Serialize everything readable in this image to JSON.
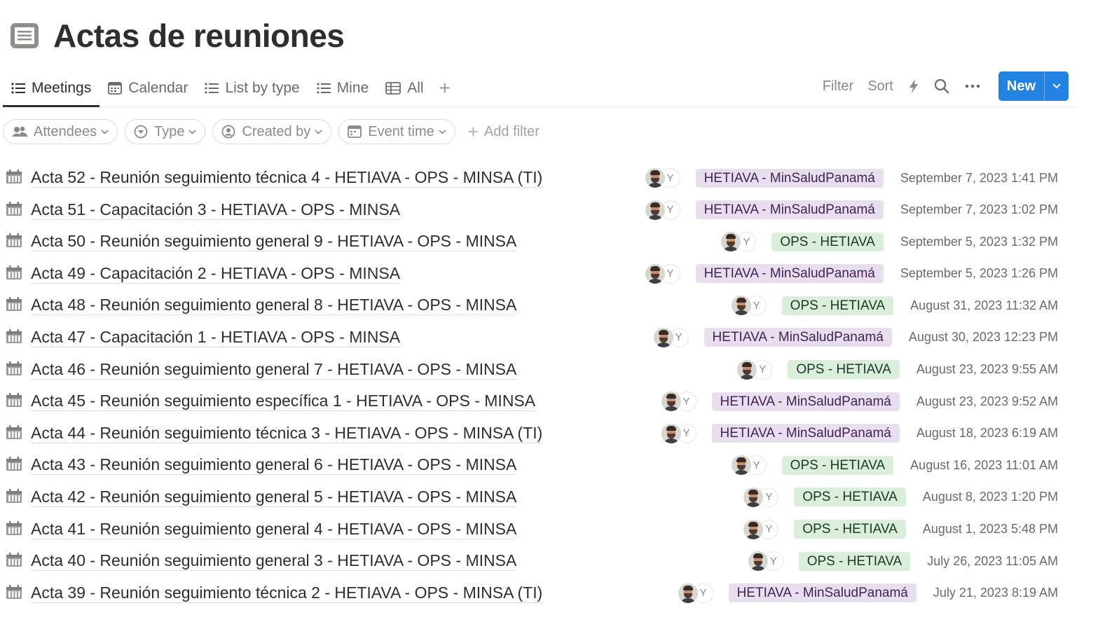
{
  "page": {
    "title": "Actas de reuniones",
    "icon": "document-icon"
  },
  "tabs": [
    {
      "label": "Meetings",
      "icon": "list-icon",
      "active": true
    },
    {
      "label": "Calendar",
      "icon": "calendar-icon",
      "active": false
    },
    {
      "label": "List by type",
      "icon": "list-icon",
      "active": false
    },
    {
      "label": "Mine",
      "icon": "list-icon",
      "active": false
    },
    {
      "label": "All",
      "icon": "table-icon",
      "active": false
    }
  ],
  "toolbar": {
    "filter_label": "Filter",
    "sort_label": "Sort",
    "new_label": "New"
  },
  "filters": [
    {
      "label": "Attendees",
      "icon": "people-icon"
    },
    {
      "label": "Type",
      "icon": "select-icon"
    },
    {
      "label": "Created by",
      "icon": "person-icon"
    },
    {
      "label": "Event time",
      "icon": "calendar-icon"
    }
  ],
  "add_filter_label": "Add filter",
  "rows": [
    {
      "title": "Acta 52 - Reunión seguimiento técnica 4 - HETIAVA - OPS - MINSA (TI)",
      "tag": "HETIAVA - MinSaludPanamá",
      "tag_color": "purple",
      "date": "September 7, 2023 1:41 PM",
      "avatar_initial": "Y"
    },
    {
      "title": "Acta 51 - Capacitación 3 - HETIAVA - OPS - MINSA",
      "tag": "HETIAVA - MinSaludPanamá",
      "tag_color": "purple",
      "date": "September 7, 2023 1:02 PM",
      "avatar_initial": "Y"
    },
    {
      "title": "Acta 50 - Reunión seguimiento general 9 - HETIAVA - OPS - MINSA",
      "tag": "OPS - HETIAVA",
      "tag_color": "green",
      "date": "September 5, 2023 1:32 PM",
      "avatar_initial": "Y"
    },
    {
      "title": "Acta 49 - Capacitación 2 - HETIAVA - OPS - MINSA",
      "tag": "HETIAVA - MinSaludPanamá",
      "tag_color": "purple",
      "date": "September 5, 2023 1:26 PM",
      "avatar_initial": "Y"
    },
    {
      "title": "Acta 48 - Reunión seguimiento general 8 - HETIAVA - OPS - MINSA",
      "tag": "OPS - HETIAVA",
      "tag_color": "green",
      "date": "August 31, 2023 11:32 AM",
      "avatar_initial": "Y"
    },
    {
      "title": "Acta 47 - Capacitación 1 - HETIAVA - OPS - MINSA",
      "tag": "HETIAVA - MinSaludPanamá",
      "tag_color": "purple",
      "date": "August 30, 2023 12:23 PM",
      "avatar_initial": "Y"
    },
    {
      "title": "Acta 46 - Reunión seguimiento general 7 - HETIAVA - OPS - MINSA",
      "tag": "OPS - HETIAVA",
      "tag_color": "green",
      "date": "August 23, 2023 9:55 AM",
      "avatar_initial": "Y"
    },
    {
      "title": "Acta 45 - Reunión seguimiento específica 1 - HETIAVA - OPS - MINSA",
      "tag": "HETIAVA - MinSaludPanamá",
      "tag_color": "purple",
      "date": "August 23, 2023 9:52 AM",
      "avatar_initial": "Y"
    },
    {
      "title": "Acta 44 - Reunión seguimiento técnica 3 - HETIAVA - OPS - MINSA (TI)",
      "tag": "HETIAVA - MinSaludPanamá",
      "tag_color": "purple",
      "date": "August 18, 2023 6:19 AM",
      "avatar_initial": "Y"
    },
    {
      "title": "Acta 43 - Reunión seguimiento general 6 - HETIAVA - OPS - MINSA",
      "tag": "OPS - HETIAVA",
      "tag_color": "green",
      "date": "August 16, 2023 11:01 AM",
      "avatar_initial": "Y"
    },
    {
      "title": "Acta 42 - Reunión seguimiento general 5 - HETIAVA - OPS - MINSA",
      "tag": "OPS - HETIAVA",
      "tag_color": "green",
      "date": "August 8, 2023 1:20 PM",
      "avatar_initial": "Y"
    },
    {
      "title": "Acta 41 - Reunión seguimiento general 4 - HETIAVA - OPS - MINSA",
      "tag": "OPS - HETIAVA",
      "tag_color": "green",
      "date": "August 1, 2023 5:48 PM",
      "avatar_initial": "Y"
    },
    {
      "title": "Acta 40 - Reunión seguimiento general 3 - HETIAVA - OPS - MINSA",
      "tag": "OPS - HETIAVA",
      "tag_color": "green",
      "date": "July 26, 2023 11:05 AM",
      "avatar_initial": "Y"
    },
    {
      "title": "Acta 39 - Reunión seguimiento técnica 2 - HETIAVA - OPS - MINSA (TI)",
      "tag": "HETIAVA - MinSaludPanamá",
      "tag_color": "purple",
      "date": "July 21, 2023 8:19 AM",
      "avatar_initial": "Y"
    }
  ],
  "colors": {
    "accent": "#2383e2",
    "tag_purple_bg": "#e8deee",
    "tag_green_bg": "#dbeddb"
  }
}
